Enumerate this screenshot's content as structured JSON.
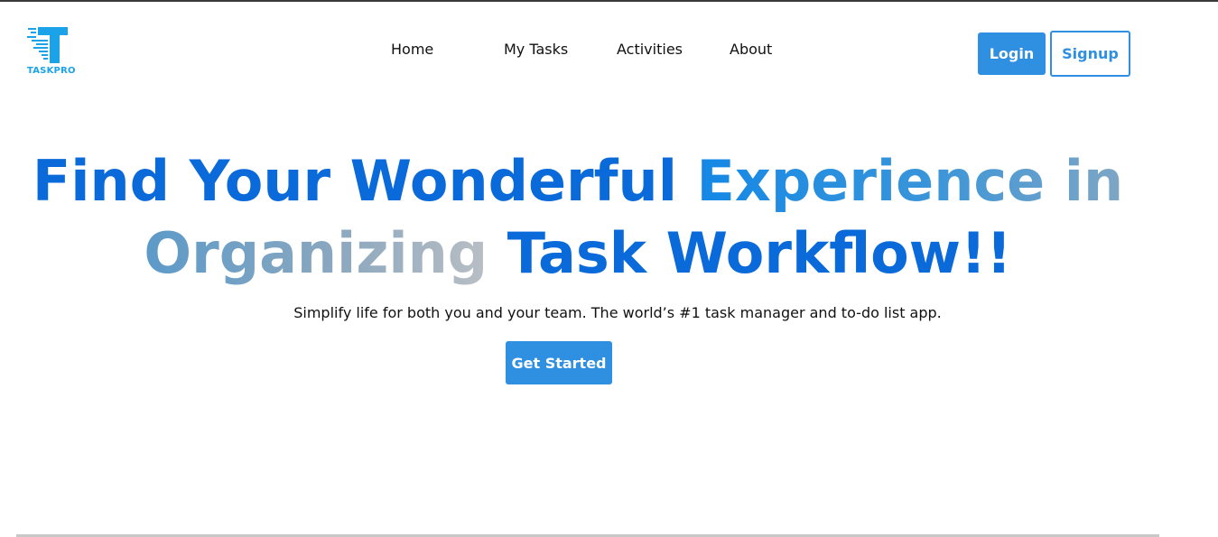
{
  "brand": {
    "name": "TASKPRO",
    "logo_icon": "taskpro-t-logo",
    "color": "#1aa3e8"
  },
  "nav": {
    "items": [
      {
        "label": "Home"
      },
      {
        "label": "My Tasks"
      },
      {
        "label": "Activities"
      },
      {
        "label": "About"
      }
    ]
  },
  "auth": {
    "login_label": "Login",
    "signup_label": "Signup"
  },
  "hero": {
    "line1_part1": "Find Your Wonderful ",
    "line1_part2": "Experience in",
    "line2_part1": "Organizing",
    "line2_part2": " Task Workflow!!",
    "subtitle": "Simplify life for both you and your team. The world’s #1 task manager and to-do list app.",
    "cta_label": "Get Started"
  },
  "colors": {
    "primary": "#2f8fe0",
    "heading_blue": "#0a6ad9"
  }
}
